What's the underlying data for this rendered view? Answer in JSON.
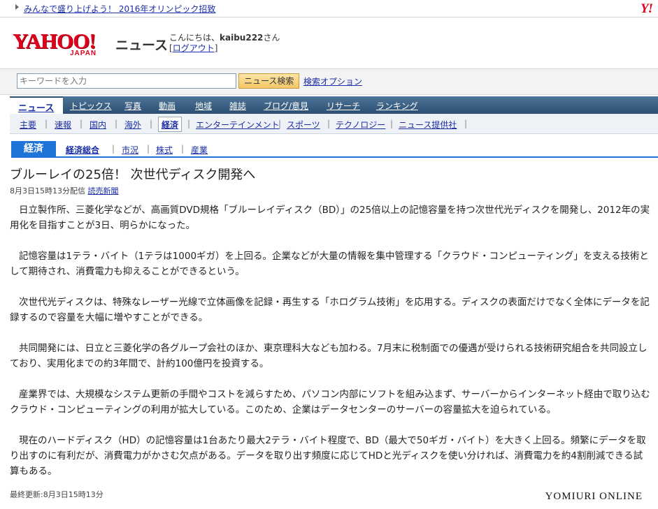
{
  "topbar": {
    "promo_text": "みんなで盛り上げよう！ 2016年オリンピック招致",
    "yahoo_mark": "Y!"
  },
  "header": {
    "logo_text": "YAHOO!",
    "logo_sub": "JAPAN",
    "service_name": "ニュース",
    "greeting_prefix": "こんにちは、",
    "username": "kaibu222",
    "greeting_suffix": "さん",
    "logout_open": "[",
    "logout_label": "ログアウト",
    "logout_close": "]"
  },
  "search": {
    "placeholder": "キーワードを入力",
    "button_label": "ニュース検索",
    "options_label": "検索オプション"
  },
  "nav_primary": {
    "active": "ニュース",
    "items": [
      "トピックス",
      "写真",
      "動画",
      "地域",
      "雑誌",
      "ブログ/意見",
      "リサーチ",
      "ランキング"
    ]
  },
  "nav_secondary": {
    "items": [
      "主要",
      "速報",
      "国内",
      "海外",
      "経済",
      "エンターテインメント",
      "スポーツ",
      "テクノロジー",
      "ニュース提供社"
    ],
    "active": "経済"
  },
  "category": {
    "badge": "経済",
    "items": [
      "経済総合",
      "市況",
      "株式",
      "産業"
    ]
  },
  "article": {
    "headline": "ブルーレイの25倍！ 次世代ディスク開発へ",
    "date": "8月3日15時13分配信",
    "source": "読売新聞",
    "paragraphs": [
      "日立製作所、三菱化学などが、高画質DVD規格「ブルーレイディスク（BD）」の25倍以上の記憶容量を持つ次世代光ディスクを開発し、2012年の実用化を目指すことが3日、明らかになった。",
      "記憶容量は1テラ・バイト（1テラは1000ギガ）を上回る。企業などが大量の情報を集中管理する「クラウド・コンピューティング」を支える技術として期待され、消費電力も抑えることができるという。",
      "次世代光ディスクは、特殊なレーザー光線で立体画像を記録・再生する「ホログラム技術」を応用する。ディスクの表面だけでなく全体にデータを記録するので容量を大幅に増やすことができる。",
      "共同開発には、日立と三菱化学の各グループ会社のほか、東京理科大なども加わる。7月末に税制面での優遇が受けられる技術研究組合を共同設立しており、実用化までの約3年間で、計約100億円を投資する。",
      "産業界では、大規模なシステム更新の手間やコストを減らすため、パソコン内部にソフトを組み込まず、サーバーからインターネット経由で取り込むクラウド・コンピューティングの利用が拡大している。このため、企業はデータセンターのサーバーの容量拡大を迫られている。",
      "現在のハードディスク（HD）の記憶容量は1台あたり最大2テラ・バイト程度で、BD（最大で50ギガ・バイト）を大きく上回る。頻繁にデータを取り出すのに有利だが、消費電力がかさむ欠点がある。データを取り出す頻度に応じてHDと光ディスクを使い分ければ、消費電力を約4割削減できる試算もある。"
    ],
    "updated": "最終更新:8月3日15時13分",
    "publisher_logo": "YOMIURI ONLINE"
  }
}
